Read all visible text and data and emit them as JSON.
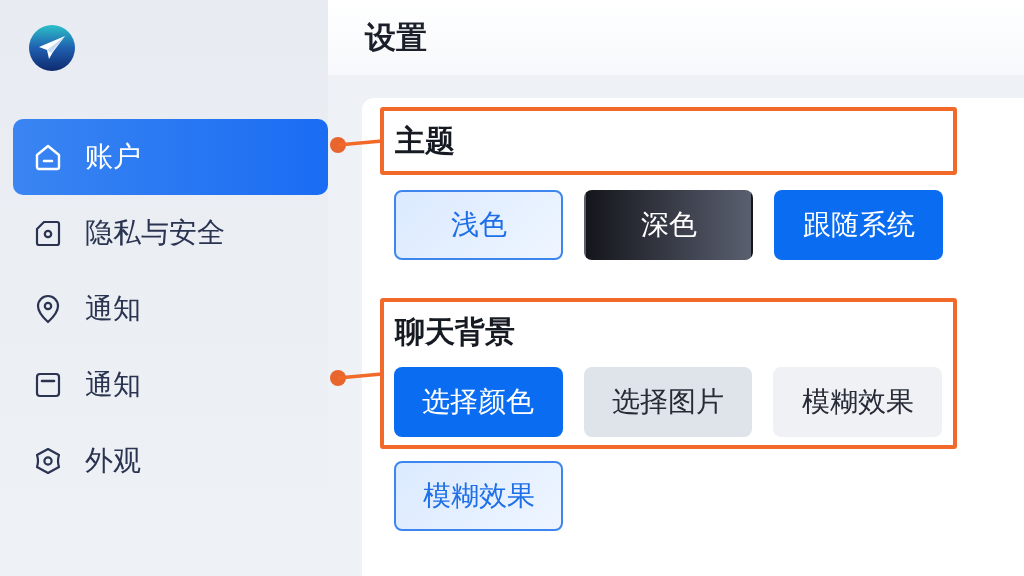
{
  "sidebar": {
    "items": [
      {
        "label": "账户",
        "kind": "home",
        "selected": true
      },
      {
        "label": "隐私与安全",
        "kind": "tag",
        "selected": false
      },
      {
        "label": "通知",
        "kind": "pin",
        "selected": false
      },
      {
        "label": "通知",
        "kind": "window",
        "selected": false
      },
      {
        "label": "外观",
        "kind": "hexagon",
        "selected": false
      }
    ]
  },
  "header": {
    "title": "设置"
  },
  "sections": [
    {
      "title": "主题",
      "kind": "heading",
      "highlighted": true,
      "options": [
        {
          "label": "浅色",
          "kind": "outline"
        },
        {
          "label": "深色",
          "kind": "dark"
        },
        {
          "label": "跟随系统",
          "kind": "primary"
        }
      ]
    },
    {
      "title": "聊天背景",
      "kind": "group",
      "highlighted": true,
      "options": [
        {
          "label": "选择颜色",
          "kind": "primary"
        },
        {
          "label": "选择图片",
          "kind": "muted"
        },
        {
          "label": "模糊效果",
          "kind": "light"
        }
      ]
    }
  ],
  "extra_options": [
    {
      "label": "模糊效果",
      "kind": "outline"
    }
  ]
}
